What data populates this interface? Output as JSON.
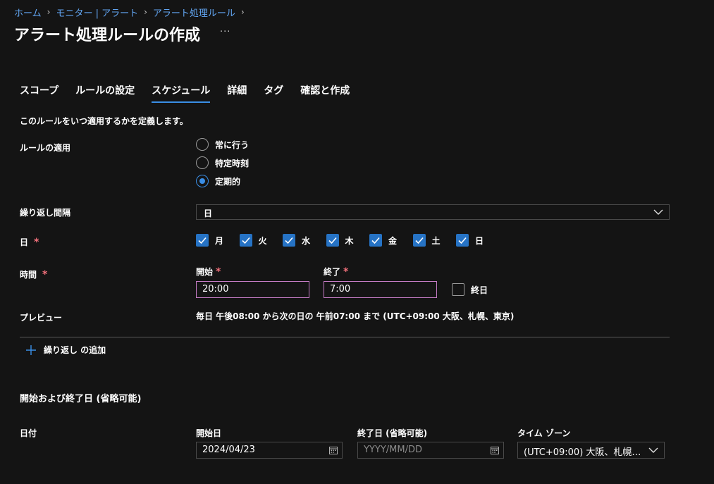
{
  "breadcrumb": [
    {
      "label": "ホーム"
    },
    {
      "label": "モニター | アラート"
    },
    {
      "label": "アラート処理ルール"
    }
  ],
  "page": {
    "title": "アラート処理ルールの作成",
    "more_label": "···"
  },
  "tabs": [
    {
      "label": "スコープ",
      "active": false
    },
    {
      "label": "ルールの設定",
      "active": false
    },
    {
      "label": "スケジュール",
      "active": true
    },
    {
      "label": "詳細",
      "active": false
    },
    {
      "label": "タグ",
      "active": false
    },
    {
      "label": "確認と作成",
      "active": false
    }
  ],
  "schedule": {
    "description": "このルールをいつ適用するかを定義します。",
    "apply": {
      "label": "ルールの適用",
      "options": [
        {
          "label": "常に行う",
          "selected": false
        },
        {
          "label": "特定時刻",
          "selected": false
        },
        {
          "label": "定期的",
          "selected": true
        }
      ]
    },
    "repeat": {
      "label": "繰り返し間隔",
      "value": "日"
    },
    "days": {
      "label": "日",
      "required_mark": "*",
      "items": [
        {
          "label": "月",
          "checked": true
        },
        {
          "label": "火",
          "checked": true
        },
        {
          "label": "水",
          "checked": true
        },
        {
          "label": "木",
          "checked": true
        },
        {
          "label": "金",
          "checked": true
        },
        {
          "label": "土",
          "checked": true
        },
        {
          "label": "日",
          "checked": true
        }
      ]
    },
    "time": {
      "label": "時間",
      "required_mark": "*",
      "start_label": "開始",
      "start_value": "20:00",
      "end_label": "終了",
      "end_value": "7:00",
      "all_day_label": "終日",
      "all_day_checked": false
    },
    "preview": {
      "label": "プレビュー",
      "text": "毎日 午後08:00 から次の日の 午前07:00 まで (UTC+09:00 大阪、札幌、東京)"
    },
    "add_repeat_label": "繰り返し の追加"
  },
  "date_range": {
    "section_title": "開始および終了日 (省略可能)",
    "row_label": "日付",
    "start_date_label": "開始日",
    "start_date_value": "2024/04/23",
    "end_date_label": "終了日 (省略可能)",
    "end_date_placeholder": "YYYY/MM/DD",
    "timezone_label": "タイム ゾーン",
    "timezone_value": "(UTC+09:00) 大阪、札幌…"
  },
  "colors": {
    "accent": "#3a8ee6",
    "link": "#62a6f3",
    "required": "#f1707b",
    "background": "#141414"
  }
}
